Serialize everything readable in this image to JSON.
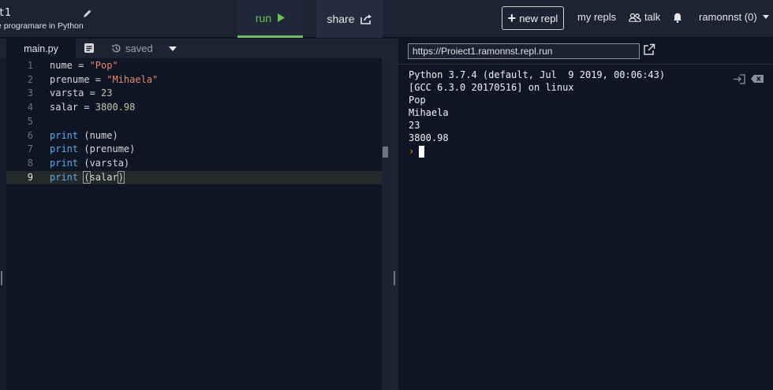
{
  "header": {
    "project_title": "t1",
    "project_description": "e programare in Python",
    "run_label": "run",
    "share_label": "share",
    "new_repl_label": "new repl",
    "my_repls_label": "my repls",
    "talk_label": "talk",
    "user_label": "ramonnst (0)"
  },
  "editor": {
    "file_tab": "main.py",
    "saved_label": "saved",
    "lines": [
      {
        "num": "1",
        "code": "nume = \"Pop\""
      },
      {
        "num": "2",
        "code": "prenume = \"Mihaela\""
      },
      {
        "num": "3",
        "code": "varsta = 23"
      },
      {
        "num": "4",
        "code": "salar = 3800.98"
      },
      {
        "num": "5",
        "code": ""
      },
      {
        "num": "6",
        "code": "print (nume)"
      },
      {
        "num": "7",
        "code": "print (prenume)"
      },
      {
        "num": "8",
        "code": "print (varsta)"
      },
      {
        "num": "9",
        "code": "print (salar)"
      }
    ],
    "active_line": 9
  },
  "console": {
    "url": "https://Proiect1.ramonnst.repl.run",
    "output": [
      "Python 3.7.4 (default, Jul  9 2019, 00:06:43)",
      "[GCC 6.3.0 20170516] on linux",
      "Pop",
      "Mihaela",
      "23",
      "3800.98"
    ],
    "prompt_symbol": "›"
  },
  "icons": [
    "pencil-icon",
    "play-icon",
    "share-icon",
    "plus-icon",
    "people-icon",
    "bell-icon",
    "caret-down-icon",
    "document-icon",
    "history-icon",
    "external-link-icon",
    "exit-icon",
    "clear-icon"
  ],
  "colors": {
    "run_green": "#6bbf59",
    "background": "#0e1525",
    "panel": "#1c2333",
    "keyword": "#5ea9e8",
    "string": "#e58a6a",
    "number": "#b5cea8",
    "prompt": "#f0a020"
  }
}
